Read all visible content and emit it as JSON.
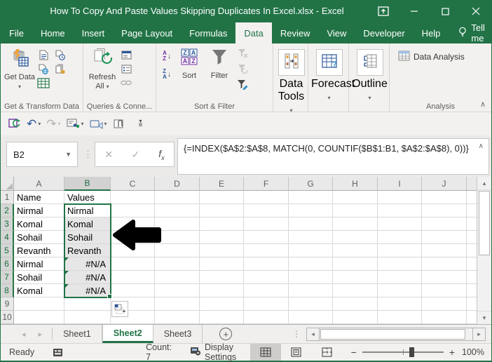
{
  "window": {
    "title": "How To Copy And Paste Values Skipping Duplicates In Excel.xlsx  -  Excel"
  },
  "menu": {
    "tabs": [
      "File",
      "Home",
      "Insert",
      "Page Layout",
      "Formulas",
      "Data",
      "Review",
      "View",
      "Developer",
      "Help"
    ],
    "active": "Data",
    "tell_me": "Tell me"
  },
  "ribbon": {
    "groups": [
      "Get & Transform Data",
      "Queries & Conne...",
      "Sort & Filter",
      "Data Tools",
      "Forecast",
      "Outline",
      "Analysis"
    ],
    "get_data": "Get Data",
    "refresh_all": "Refresh All",
    "sort": "Sort",
    "filter": "Filter",
    "data_tools": "Data Tools",
    "forecast": "Forecast",
    "outline": "Outline",
    "data_analysis": "Data Analysis"
  },
  "formula_bar": {
    "name_box": "B2",
    "fx": "fx",
    "formula": "{=INDEX($A$2:$A$8, MATCH(0, COUNTIF($B$1:B1, $A$2:$A$8), 0))}"
  },
  "grid": {
    "columns": [
      "A",
      "B",
      "C",
      "D",
      "E",
      "F",
      "G",
      "H",
      "I",
      "J"
    ],
    "rows": [
      {
        "n": "1",
        "A": "Name",
        "B": "Values"
      },
      {
        "n": "2",
        "A": "Nirmal",
        "B": "Nirmal"
      },
      {
        "n": "3",
        "A": "Komal",
        "B": "Komal"
      },
      {
        "n": "4",
        "A": "Sohail",
        "B": "Sohail"
      },
      {
        "n": "5",
        "A": "Revanth",
        "B": "Revanth"
      },
      {
        "n": "6",
        "A": "Nirmal",
        "B": "#N/A"
      },
      {
        "n": "7",
        "A": "Sohail",
        "B": "#N/A"
      },
      {
        "n": "8",
        "A": "Komal",
        "B": "#N/A"
      },
      {
        "n": "9",
        "A": "",
        "B": ""
      },
      {
        "n": "10",
        "A": "",
        "B": ""
      }
    ],
    "selection": {
      "column": "B",
      "first_row": 2,
      "last_row": 8,
      "active_cell": "B2",
      "error_cells": [
        "B6",
        "B7",
        "B8"
      ]
    }
  },
  "sheets": {
    "tabs": [
      "Sheet1",
      "Sheet2",
      "Sheet3"
    ],
    "active": "Sheet2"
  },
  "status": {
    "ready": "Ready",
    "count": "Count: 7",
    "display_settings": "Display Settings",
    "zoom": "100%"
  },
  "colors": {
    "excel_green": "#217346",
    "selection_border": "#217346",
    "selection_fill": "#e6e6e6",
    "error_indicator": "#1e7145"
  }
}
